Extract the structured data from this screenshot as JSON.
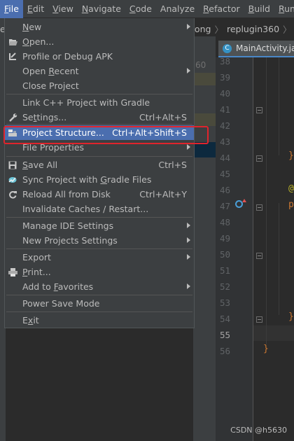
{
  "menubar": [
    {
      "label": "File",
      "hot": "F",
      "rest": "ile",
      "active": true
    },
    {
      "label": "Edit",
      "hot": "E",
      "rest": "dit"
    },
    {
      "label": "View",
      "hot": "V",
      "rest": "iew"
    },
    {
      "label": "Navigate",
      "hot": "N",
      "rest": "avigate"
    },
    {
      "label": "Code",
      "hot": "C",
      "rest": "ode"
    },
    {
      "label": "Analyze",
      "hot": "",
      "rest": "Analyze"
    },
    {
      "label": "Refactor",
      "hot": "R",
      "rest": "efactor"
    },
    {
      "label": "Build",
      "hot": "B",
      "rest": "uild"
    },
    {
      "label": "Run",
      "hot": "R",
      "rest": "un"
    }
  ],
  "breadcrumb": [
    "hong",
    "replugin360"
  ],
  "background_fragments": {
    "left_e": "e",
    "line_360": "60"
  },
  "editor_tab": {
    "label": "MainActivity.java",
    "icon": "C"
  },
  "file_menu": {
    "items": [
      {
        "label": "New",
        "ul": "N",
        "icon": "",
        "shortcut": "",
        "submenu": true
      },
      {
        "label": "Open...",
        "ul": "O",
        "icon": "folder-open-icon",
        "shortcut": "",
        "submenu": false
      },
      {
        "label": "Profile or Debug APK",
        "ul": "",
        "icon": "profile-apk-icon",
        "shortcut": "",
        "submenu": false
      },
      {
        "label": "Open Recent",
        "ul": "R",
        "icon": "",
        "shortcut": "",
        "submenu": true
      },
      {
        "label": "Close Project",
        "ul": "",
        "icon": "",
        "shortcut": "",
        "submenu": false
      },
      {
        "label": "Link C++ Project with Gradle",
        "ul": "",
        "icon": "",
        "shortcut": "",
        "submenu": false
      },
      {
        "label": "Settings...",
        "ul": "t",
        "icon": "wrench-icon",
        "shortcut": "Ctrl+Alt+S",
        "submenu": false
      },
      {
        "label": "Project Structure...",
        "ul": "",
        "icon": "project-structure-icon",
        "shortcut": "Ctrl+Alt+Shift+S",
        "submenu": false,
        "selected": true
      },
      {
        "label": "File Properties",
        "ul": "",
        "icon": "",
        "shortcut": "",
        "submenu": true
      },
      {
        "label": "Save All",
        "ul": "S",
        "icon": "save-icon",
        "shortcut": "Ctrl+S",
        "submenu": false
      },
      {
        "label": "Sync Project with Gradle Files",
        "ul": "G",
        "icon": "gradle-sync-icon",
        "shortcut": "",
        "submenu": false
      },
      {
        "label": "Reload All from Disk",
        "ul": "",
        "icon": "reload-icon",
        "shortcut": "Ctrl+Alt+Y",
        "submenu": false
      },
      {
        "label": "Invalidate Caches / Restart...",
        "ul": "",
        "icon": "",
        "shortcut": "",
        "submenu": false
      },
      {
        "label": "Manage IDE Settings",
        "ul": "",
        "icon": "",
        "shortcut": "",
        "submenu": true
      },
      {
        "label": "New Projects Settings",
        "ul": "",
        "icon": "",
        "shortcut": "",
        "submenu": true
      },
      {
        "label": "Export",
        "ul": "",
        "icon": "",
        "shortcut": "",
        "submenu": true
      },
      {
        "label": "Print...",
        "ul": "P",
        "icon": "print-icon",
        "shortcut": "",
        "submenu": false
      },
      {
        "label": "Add to Favorites",
        "ul": "F",
        "icon": "",
        "shortcut": "",
        "submenu": true
      },
      {
        "label": "Power Save Mode",
        "ul": "",
        "icon": "",
        "shortcut": "",
        "submenu": false
      },
      {
        "label": "Exit",
        "ul": "x",
        "icon": "",
        "shortcut": "",
        "submenu": false
      }
    ]
  },
  "line_numbers": [
    "38",
    "39",
    "40",
    "41",
    "42",
    "43",
    "44",
    "45",
    "46",
    "47",
    "48",
    "49",
    "50",
    "51",
    "52",
    "53",
    "54",
    "55",
    "56"
  ],
  "current_line": "55",
  "code_fragments": {
    "brace": "}",
    "at": "@",
    "p": "p"
  },
  "colors": {
    "accent": "#4b6eaf",
    "highlight_box": "#e0242c",
    "keyword": "#cc7832",
    "annotation": "#bbb529"
  },
  "watermark": "CSDN @h5630"
}
